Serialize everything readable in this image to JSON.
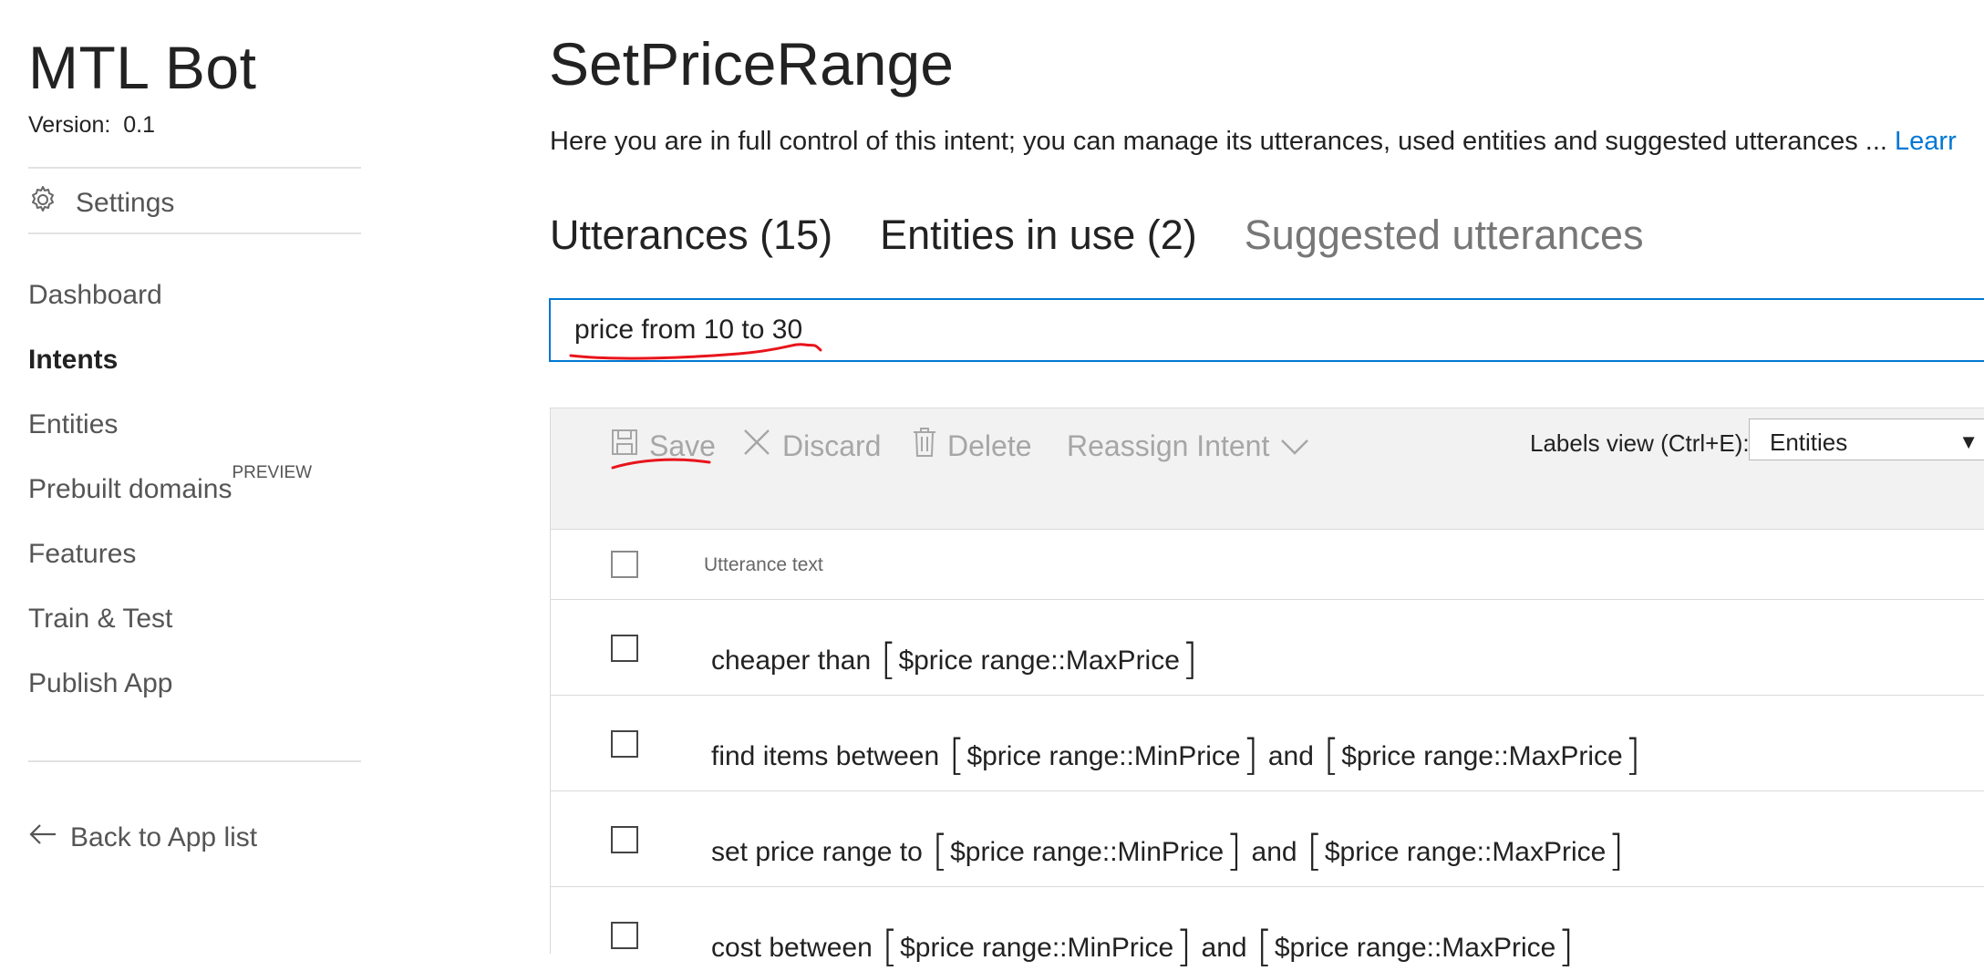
{
  "app": {
    "name": "MTL Bot",
    "version_label": "Version:",
    "version": "0.1"
  },
  "sidebar": {
    "settings_label": "Settings",
    "items": [
      {
        "label": "Dashboard"
      },
      {
        "label": "Intents",
        "active": true
      },
      {
        "label": "Entities"
      },
      {
        "label": "Prebuilt domains",
        "badge": "PREVIEW"
      },
      {
        "label": "Features"
      },
      {
        "label": "Train & Test"
      },
      {
        "label": "Publish App"
      }
    ],
    "back_label": "Back to App list"
  },
  "intent": {
    "title": "SetPriceRange",
    "description": "Here you are in full control of this intent; you can manage its utterances, used entities and suggested utterances ...",
    "learn_more": "Learr"
  },
  "tabs": [
    {
      "label": "Utterances (15)",
      "active": true
    },
    {
      "label": "Entities in use (2)"
    },
    {
      "label": "Suggested utterances"
    }
  ],
  "utterance_input": {
    "value": "price from 10 to 30"
  },
  "toolbar": {
    "save": "Save",
    "discard": "Discard",
    "delete": "Delete",
    "reassign": "Reassign Intent",
    "labels_view_label": "Labels view (Ctrl+E):",
    "labels_view_value": "Entities"
  },
  "table": {
    "column_header": "Utterance text",
    "rows": [
      {
        "prefix": "cheaper than ",
        "entity1": "$price range::MaxPrice"
      },
      {
        "prefix": "find items between ",
        "entity1": "$price range::MinPrice",
        "mid": " and ",
        "entity2": "$price range::MaxPrice"
      },
      {
        "prefix": "set price range to ",
        "entity1": "$price range::MinPrice",
        "mid": " and ",
        "entity2": "$price range::MaxPrice"
      },
      {
        "prefix": "cost between ",
        "entity1": "$price range::MinPrice",
        "mid": " and ",
        "entity2": "$price range::MaxPrice"
      }
    ]
  },
  "colors": {
    "accent": "#0078d4",
    "annotation": "#e8141c",
    "disabled": "#a6a6a6"
  }
}
